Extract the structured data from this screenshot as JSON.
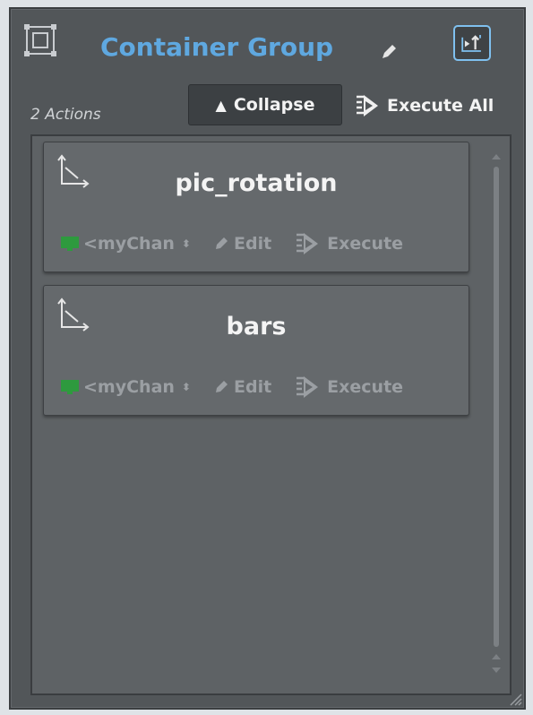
{
  "header": {
    "title": "Container Group",
    "action_count": "2 Actions",
    "collapse_label": "Collapse",
    "execute_all_label": "Execute All",
    "icons": [
      "container-group-icon",
      "pencil-icon",
      "pin-icon",
      "triangle-up-icon",
      "execute-all-icon"
    ]
  },
  "actions": [
    {
      "name": "pic_rotation",
      "channel": "<myChan",
      "edit_label": "Edit",
      "execute_label": "Execute"
    },
    {
      "name": "bars",
      "channel": "<myChan",
      "edit_label": "Edit",
      "execute_label": "Execute"
    }
  ],
  "colors": {
    "title": "#5fa8e0",
    "panel_bg": "#525659",
    "list_bg": "#5e6265",
    "card_bg": "#65696c",
    "channel_monitor": "#2e9a3e",
    "accent_border": "#7fc0ef"
  }
}
